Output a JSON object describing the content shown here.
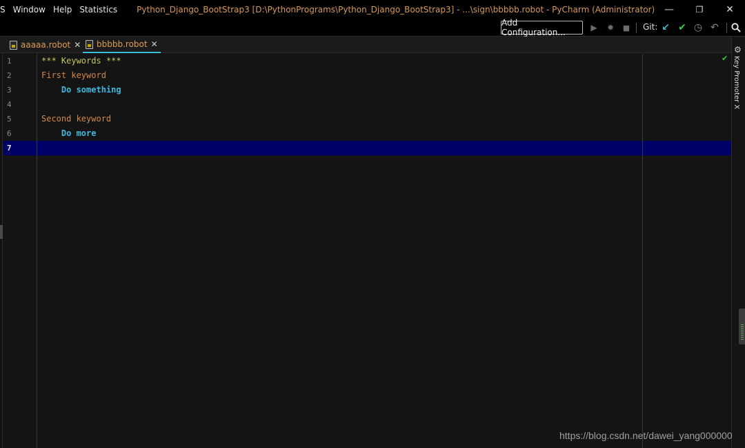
{
  "menu": {
    "items": [
      "S",
      "Window",
      "Help",
      "Statistics"
    ]
  },
  "window_title": "Python_Django_BootStrap3 [D:\\PythonPrograms\\Python_Django_BootStrap3] - ...\\sign\\bbbbb.robot - PyCharm (Administrator)",
  "window_controls": {
    "minimize": "—",
    "restore": "❐",
    "close": "✕"
  },
  "toolbar": {
    "add_configuration": "Add Configuration...",
    "run_icon": "▶",
    "debug_icon": "✹",
    "stop_icon": "■",
    "git_label": "Git:",
    "git_update_icon": "↙",
    "git_commit_icon": "✔",
    "git_history_icon": "◷",
    "git_rollback_icon": "↶",
    "search_icon": "⚲"
  },
  "tabs": [
    {
      "label": "aaaaa.robot",
      "close": "✕",
      "active": false
    },
    {
      "label": "bbbbb.robot",
      "close": "✕",
      "active": true
    }
  ],
  "editor": {
    "lines": [
      {
        "number": "1",
        "text": "*** Keywords ***"
      },
      {
        "number": "2",
        "text": "First keyword"
      },
      {
        "number": "3",
        "text": "    Do something"
      },
      {
        "number": "4",
        "text": ""
      },
      {
        "number": "5",
        "text": "Second keyword"
      },
      {
        "number": "6",
        "text": "    Do more"
      },
      {
        "number": "7",
        "text": ""
      }
    ],
    "current_line": 7,
    "inspection_status": "✔"
  },
  "right_panel": {
    "label": "Key Promoter X",
    "gear_icon": "⚙"
  },
  "watermark": "https://blog.csdn.net/dawei_yang000000",
  "colors": {
    "title": "#d89a52",
    "tab_text": "#e09a56",
    "tab_active_underline": "#3bbfd8",
    "section_header": "#c7c760",
    "keyword_definition": "#d3884a",
    "keyword_call": "#3fb8e0",
    "current_line_bg": "#00006b",
    "check": "#2fcf3f"
  }
}
